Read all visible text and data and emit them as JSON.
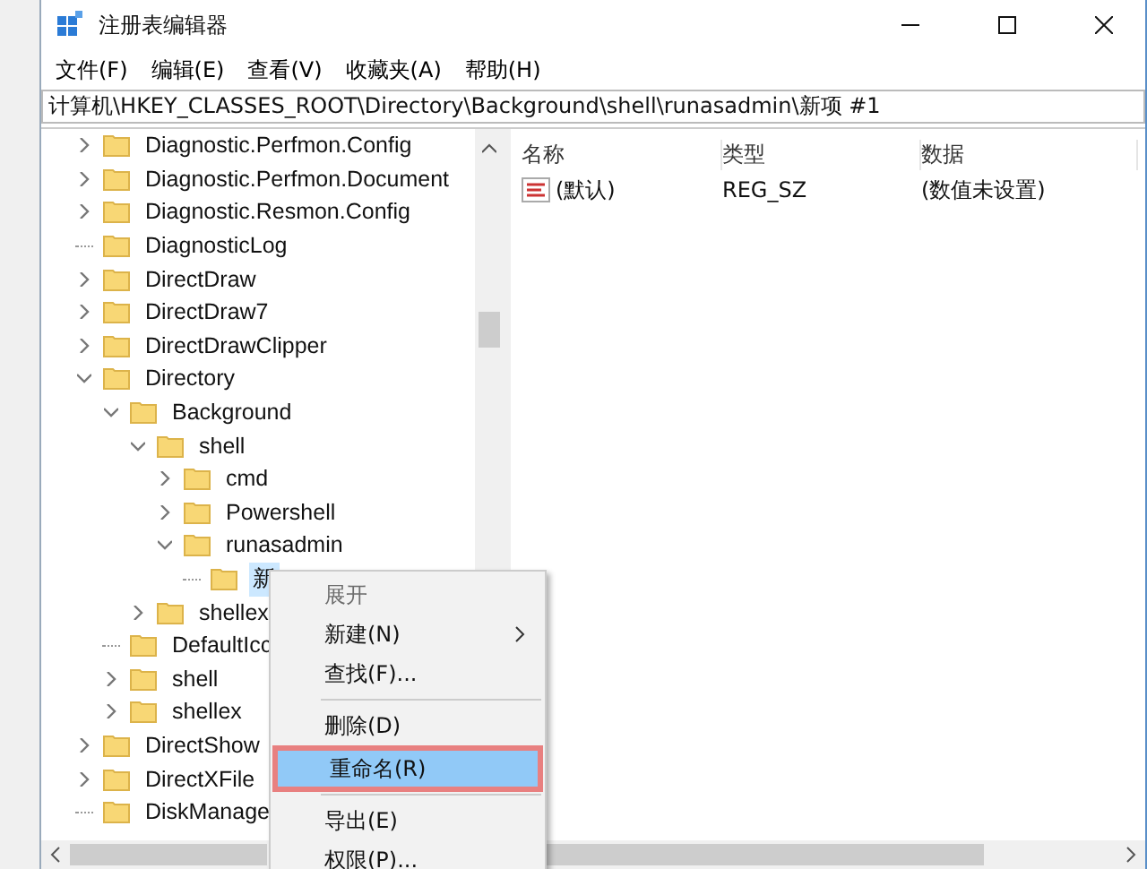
{
  "window": {
    "title": "注册表编辑器"
  },
  "menu_bar": [
    "文件(F)",
    "编辑(E)",
    "查看(V)",
    "收藏夹(A)",
    "帮助(H)"
  ],
  "address": "计算机\\HKEY_CLASSES_ROOT\\Directory\\Background\\shell\\runasadmin\\新项 #1",
  "tree": [
    {
      "label": "Diagnostic.Perfmon.Config",
      "kind": "branch",
      "expanded": false,
      "selected": false
    },
    {
      "label": "Diagnostic.Perfmon.Document",
      "kind": "branch",
      "expanded": false,
      "selected": false
    },
    {
      "label": "Diagnostic.Resmon.Config",
      "kind": "branch",
      "expanded": false,
      "selected": false
    },
    {
      "label": "DiagnosticLog",
      "kind": "leaf",
      "selected": false
    },
    {
      "label": "DirectDraw",
      "kind": "branch",
      "expanded": false,
      "selected": false
    },
    {
      "label": "DirectDraw7",
      "kind": "branch",
      "expanded": false,
      "selected": false
    },
    {
      "label": "DirectDrawClipper",
      "kind": "branch",
      "expanded": false,
      "selected": false
    },
    {
      "label": "Directory",
      "kind": "branch",
      "expanded": true,
      "selected": false,
      "children": [
        {
          "label": "Background",
          "kind": "branch",
          "expanded": true,
          "selected": false,
          "children": [
            {
              "label": "shell",
              "kind": "branch",
              "expanded": true,
              "selected": false,
              "children": [
                {
                  "label": "cmd",
                  "kind": "branch",
                  "expanded": false,
                  "selected": false
                },
                {
                  "label": "Powershell",
                  "kind": "branch",
                  "expanded": false,
                  "selected": false
                },
                {
                  "label": "runasadmin",
                  "kind": "branch",
                  "expanded": true,
                  "selected": false,
                  "children": [
                    {
                      "label": "新",
                      "kind": "leaf",
                      "selected": true
                    }
                  ]
                }
              ]
            },
            {
              "label": "shellex",
              "kind": "branch",
              "expanded": false,
              "selected": false
            }
          ]
        },
        {
          "label": "DefaultIcc",
          "kind": "leaf",
          "selected": false
        },
        {
          "label": "shell",
          "kind": "branch",
          "expanded": false,
          "selected": false
        },
        {
          "label": "shellex",
          "kind": "branch",
          "expanded": false,
          "selected": false
        }
      ]
    },
    {
      "label": "DirectShow",
      "kind": "branch",
      "expanded": false,
      "selected": false
    },
    {
      "label": "DirectXFile",
      "kind": "branch",
      "expanded": false,
      "selected": false
    },
    {
      "label": "DiskManage",
      "kind": "leaf",
      "selected": false
    }
  ],
  "values": {
    "columns": [
      "名称",
      "类型",
      "数据"
    ],
    "rows": [
      {
        "name": "(默认)",
        "type": "REG_SZ",
        "data": "(数值未设置)"
      }
    ]
  },
  "context_menu": [
    {
      "kind": "item",
      "label": "展开",
      "disabled": true,
      "submenu": false,
      "selected": false
    },
    {
      "kind": "item",
      "label": "新建(N)",
      "disabled": false,
      "submenu": true,
      "selected": false
    },
    {
      "kind": "item",
      "label": "查找(F)...",
      "disabled": false,
      "submenu": false,
      "selected": false
    },
    {
      "kind": "separator"
    },
    {
      "kind": "item",
      "label": "删除(D)",
      "disabled": false,
      "submenu": false,
      "selected": false
    },
    {
      "kind": "item",
      "label": "重命名(R)",
      "disabled": false,
      "submenu": false,
      "selected": true
    },
    {
      "kind": "separator"
    },
    {
      "kind": "item",
      "label": "导出(E)",
      "disabled": false,
      "submenu": false,
      "selected": false
    },
    {
      "kind": "item",
      "label": "权限(P)...",
      "disabled": false,
      "submenu": false,
      "selected": false
    }
  ]
}
